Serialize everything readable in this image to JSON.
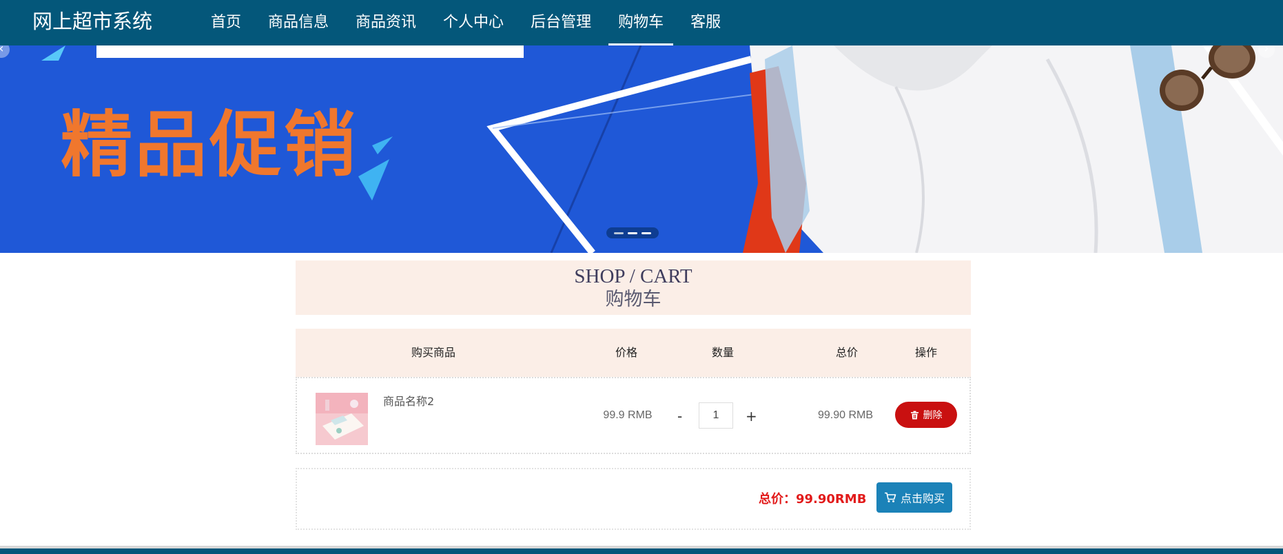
{
  "header": {
    "brand": "网上超市系统",
    "nav": [
      {
        "label": "首页",
        "active": false
      },
      {
        "label": "商品信息",
        "active": false
      },
      {
        "label": "商品资讯",
        "active": false
      },
      {
        "label": "个人中心",
        "active": false
      },
      {
        "label": "后台管理",
        "active": false
      },
      {
        "label": "购物车",
        "active": true
      },
      {
        "label": "客服",
        "active": false
      }
    ]
  },
  "banner": {
    "promo_text": "精品促销",
    "slide_count": 3,
    "current_slide": 1,
    "prev_icon": "chevron-left-icon",
    "next_icon": "chevron-right-icon"
  },
  "cart_title": {
    "en": "SHOP / CART",
    "zh": "购物车"
  },
  "table": {
    "headers": [
      "购买商品",
      "价格",
      "数量",
      "总价",
      "操作"
    ],
    "items": [
      {
        "name": "商品名称2",
        "price": "99.9 RMB",
        "quantity": "1",
        "total": "99.90 RMB",
        "delete_label": "删除",
        "minus": "-",
        "plus": "+"
      }
    ]
  },
  "summary": {
    "total_text": "总价：99.90RMB",
    "buy_label": "点击购买"
  },
  "colors": {
    "nav_bg": "#04577a",
    "cart_header_bg": "#fbeee7",
    "delete_button": "#c91010",
    "buy_button": "#1b82b8",
    "total_text": "#e21b1b"
  }
}
